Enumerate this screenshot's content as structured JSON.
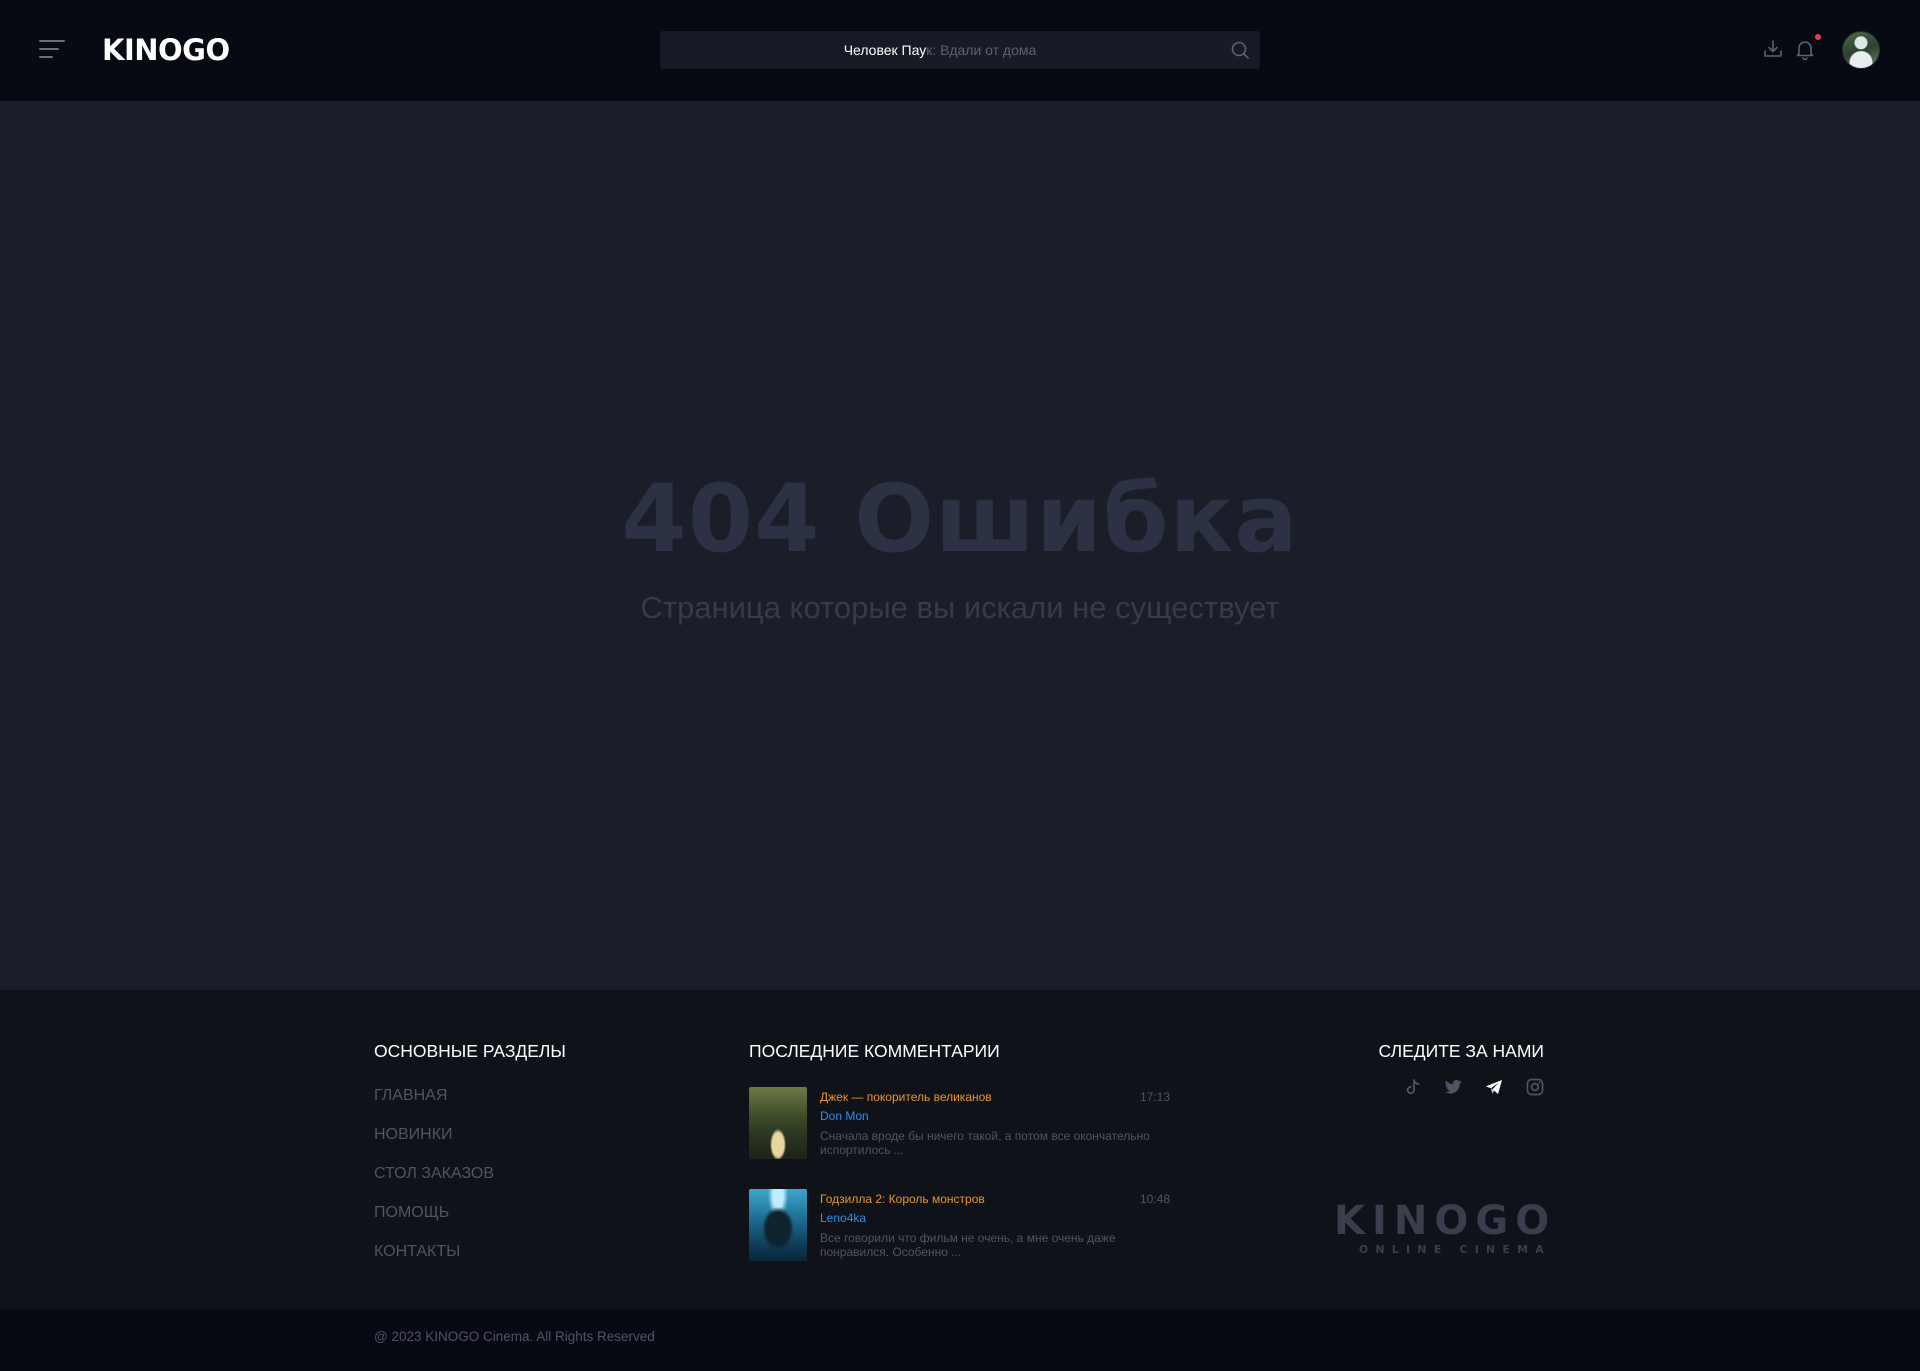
{
  "header": {
    "logo": "KINOGO",
    "search": {
      "typed": "Человек Пау",
      "placeholder": "к: Вдали от дома"
    },
    "icons": [
      "menu-icon",
      "download-icon",
      "bell-icon",
      "search-icon"
    ],
    "notification_dot_color": "#e2434b"
  },
  "main": {
    "error_title": "404 Ошибка",
    "error_subtitle": "Страница которые вы искали не существует"
  },
  "footer": {
    "sections_title": "ОСНОВНЫЕ РАЗДЕЛЫ",
    "nav": [
      {
        "label": "ГЛАВНАЯ"
      },
      {
        "label": "НОВИНКИ"
      },
      {
        "label": "СТОЛ ЗАКАЗОВ"
      },
      {
        "label": "ПОМОЩЬ"
      },
      {
        "label": "КОНТАКТЫ"
      }
    ],
    "comments_title": "ПОСЛЕДНИЕ КОММЕНТАРИИ",
    "comments": [
      {
        "title": "Джек — покоритель великанов",
        "time": "17:13",
        "user": "Don Mon",
        "text": "Сначала вроде бы ничего такой, а потом все окончательно испортилось ..."
      },
      {
        "title": "Годзилла 2: Король монстров",
        "time": "10:48",
        "user": "Leno4ka",
        "text": "Все говорили что фильм не очень, а мне очень даже понравился. Особенно ..."
      }
    ],
    "follow_title": "СЛЕДИТЕ ЗА НАМИ",
    "social": [
      "tiktok-icon",
      "twitter-icon",
      "telegram-icon",
      "instagram-icon"
    ],
    "brand_logo": {
      "main": "KINOGO",
      "sub": "ONLINE CINEMA"
    },
    "copyright": "@ 2023 KINOGO Cinema. All Rights Reserved"
  },
  "colors": {
    "accent_orange": "#e7962c",
    "link_blue": "#2d8ee8",
    "header_bg": "#070913",
    "page_bg": "#1b1d28"
  }
}
